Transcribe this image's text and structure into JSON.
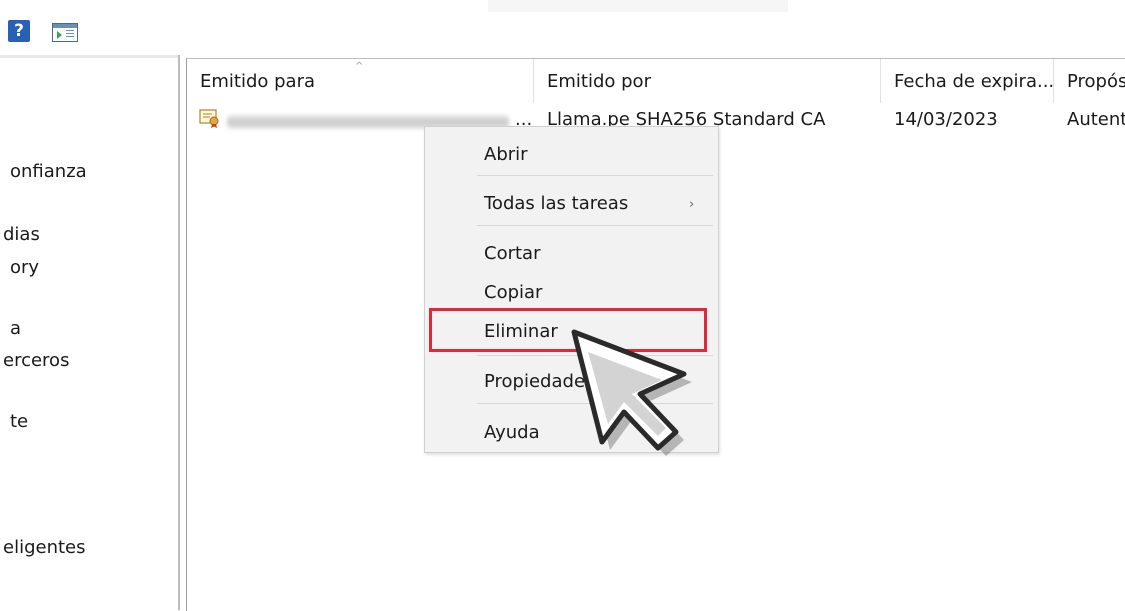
{
  "toolbar": {
    "icons": [
      "help-icon",
      "show-hide-action-pane-icon"
    ],
    "help_glyph": "?"
  },
  "left_pane": {
    "items": [
      "onfianza",
      "dias",
      "ory",
      "a",
      "erceros",
      "te",
      "eligentes"
    ]
  },
  "columns": [
    "Emitido para",
    "Emitido por",
    "Fecha de expira...",
    "Propós"
  ],
  "rows": [
    {
      "issued_to": "",
      "issued_to_trunc": "...",
      "issued_by": "Llama.pe SHA256 Standard CA",
      "expiration": "14/03/2023",
      "purpose": "Autent"
    }
  ],
  "context_menu": {
    "items": [
      "Abrir",
      "Todas las tareas",
      "Cortar",
      "Copiar",
      "Eliminar",
      "Propiedades",
      "Ayuda"
    ],
    "submenu_arrow": "›",
    "highlighted": "Eliminar",
    "highlight_color": "#e0283b"
  },
  "colors": {
    "accent_help": "#2a5fb6",
    "menu_bg": "#f2f2f2"
  }
}
